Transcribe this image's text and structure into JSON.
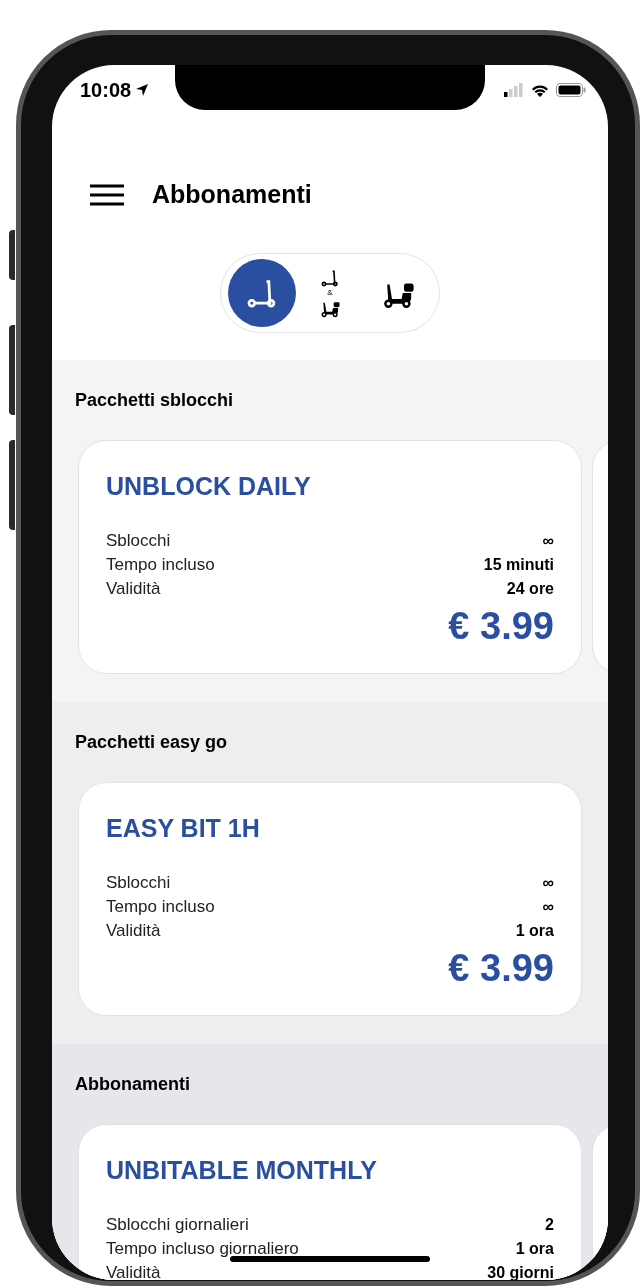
{
  "status_bar": {
    "time": "10:08"
  },
  "header": {
    "title": "Abbonamenti"
  },
  "vehicle_filter": [
    {
      "kind": "scooter",
      "selected": true
    },
    {
      "kind": "both",
      "label": "&",
      "selected": false
    },
    {
      "kind": "moped",
      "selected": false
    }
  ],
  "sections": [
    {
      "title": "Pacchetti sblocchi",
      "more_cards": true,
      "cards": [
        {
          "title": "UNBLOCK DAILY",
          "rows": [
            {
              "label": "Sblocchi",
              "value": "∞"
            },
            {
              "label": "Tempo incluso",
              "value": "15 minuti"
            },
            {
              "label": "Validità",
              "value": "24 ore"
            }
          ],
          "price": "€ 3.99"
        }
      ]
    },
    {
      "title": "Pacchetti easy go",
      "more_cards": false,
      "cards": [
        {
          "title": "EASY BIT 1H",
          "rows": [
            {
              "label": "Sblocchi",
              "value": "∞"
            },
            {
              "label": "Tempo incluso",
              "value": "∞"
            },
            {
              "label": "Validità",
              "value": "1 ora"
            }
          ],
          "price": "€ 3.99"
        }
      ]
    },
    {
      "title": "Abbonamenti",
      "more_cards": true,
      "cards": [
        {
          "title": "UNBITABLE MONTHLY",
          "rows": [
            {
              "label": "Sblocchi giornalieri",
              "value": "2"
            },
            {
              "label": "Tempo incluso giornaliero",
              "value": "1 ora"
            },
            {
              "label": "Validità",
              "value": "30 giorni"
            }
          ]
        }
      ]
    }
  ]
}
